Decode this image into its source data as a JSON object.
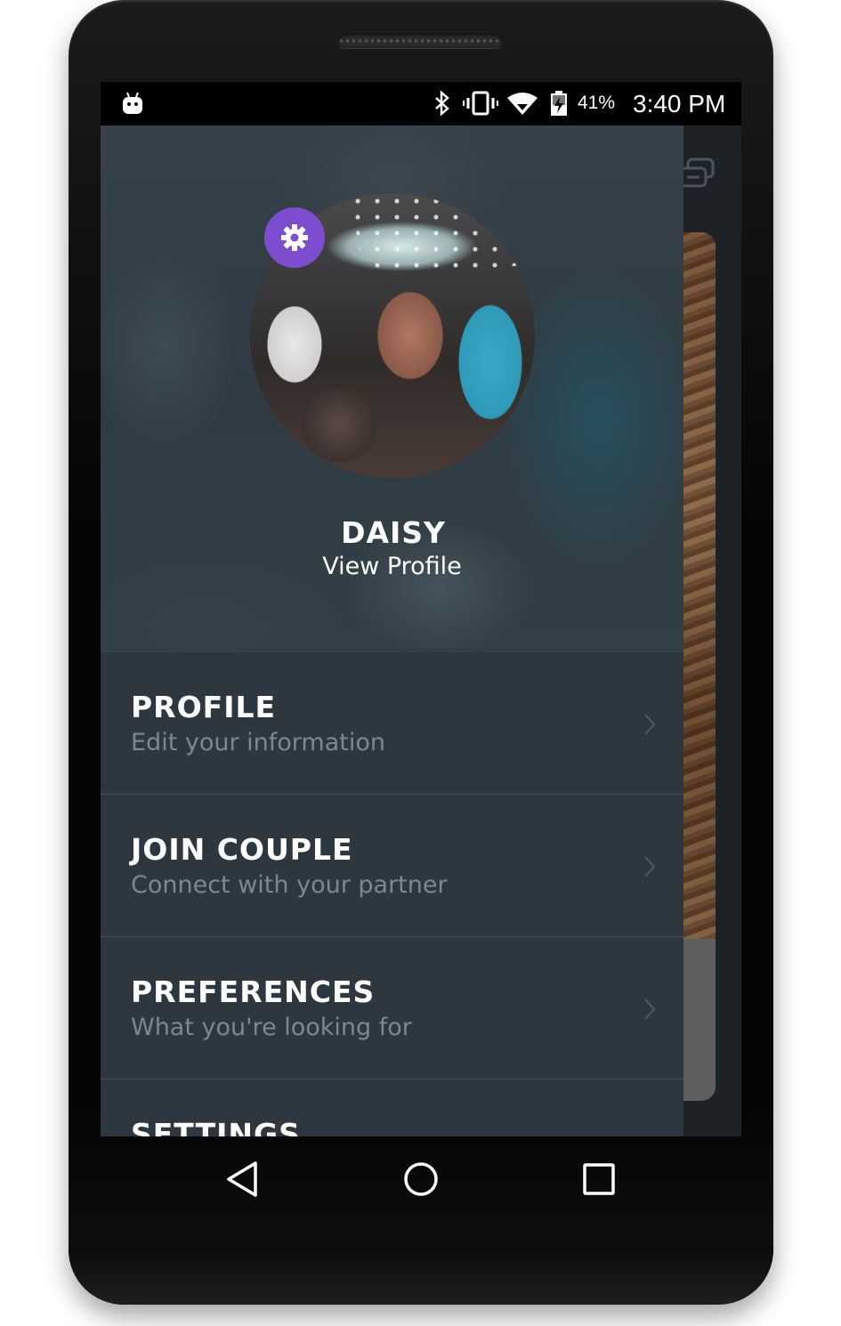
{
  "status_bar": {
    "battery_percent": "41%",
    "time": "3:40 PM",
    "icons": [
      "android-notification-icon",
      "bluetooth-icon",
      "vibrate-icon",
      "wifi-icon",
      "battery-charging-icon"
    ]
  },
  "drawer": {
    "user": {
      "name": "DAISY",
      "link": "View Profile"
    },
    "settings_icon": "gear-icon",
    "accent_color": "#7c4dce",
    "menu": [
      {
        "title": "PROFILE",
        "subtitle": "Edit your information"
      },
      {
        "title": "JOIN COUPLE",
        "subtitle": "Connect with your partner"
      },
      {
        "title": "PREFERENCES",
        "subtitle": "What you're looking for"
      },
      {
        "title": "SETTINGS",
        "subtitle": ""
      }
    ]
  },
  "background_app": {
    "icons": [
      "chat-icon"
    ]
  },
  "nav_bar": {
    "icons": [
      "back-icon",
      "home-icon",
      "recents-icon"
    ]
  }
}
